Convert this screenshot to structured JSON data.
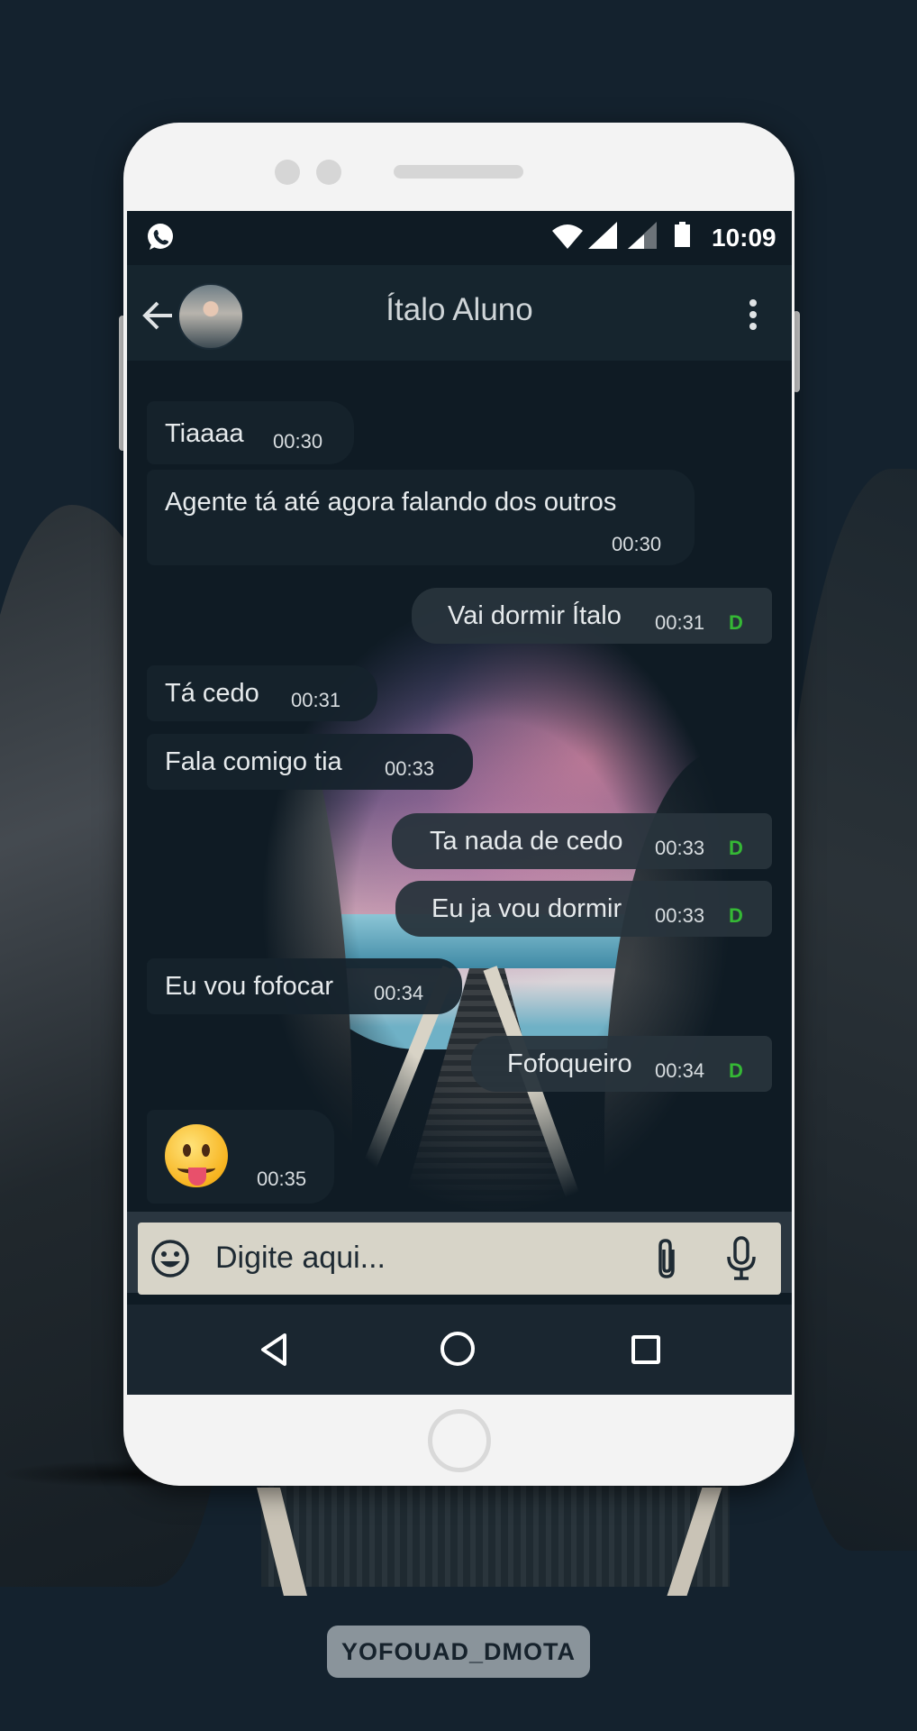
{
  "status_bar": {
    "time": "10:09",
    "left_icon": "whatsapp-icon",
    "right_icons": [
      "wifi-icon",
      "signal-icon",
      "signal-icon",
      "battery-icon"
    ]
  },
  "header": {
    "contact_name": "Ítalo Aluno",
    "back_icon": "back-arrow-icon",
    "menu_icon": "more-vertical-icon"
  },
  "messages": [
    {
      "direction": "received",
      "text": "Tiaaaa",
      "time": "00:30"
    },
    {
      "direction": "received",
      "text": "Agente tá até agora falando dos outros",
      "time": "00:30"
    },
    {
      "direction": "sent",
      "text": "Vai dormir Ítalo",
      "time": "00:31",
      "status": "D"
    },
    {
      "direction": "received",
      "text": "Tá cedo",
      "time": "00:31"
    },
    {
      "direction": "received",
      "text": "Fala comigo tia",
      "time": "00:33"
    },
    {
      "direction": "sent",
      "text": "Ta nada de cedo",
      "time": "00:33",
      "status": "D"
    },
    {
      "direction": "sent",
      "text": "Eu ja vou dormir",
      "time": "00:33",
      "status": "D"
    },
    {
      "direction": "received",
      "text": "Eu vou fofocar",
      "time": "00:34"
    },
    {
      "direction": "sent",
      "text": "Fofoqueiro",
      "time": "00:34",
      "status": "D"
    },
    {
      "direction": "received",
      "emoji": "face-with-tongue",
      "time": "00:35"
    }
  ],
  "composer": {
    "placeholder": "Digite aqui...",
    "emoji_icon": "smiley-icon",
    "attach_icon": "paperclip-icon",
    "mic_icon": "microphone-icon"
  },
  "nav": {
    "back_icon": "triangle-back-icon",
    "home_icon": "circle-home-icon",
    "recents_icon": "square-recents-icon"
  },
  "watermark": "YOFOUAD_DMOTA",
  "colors": {
    "delivered_tick": "#35b935",
    "header_bg": "#17252f",
    "input_bg": "#d7d4c8"
  }
}
